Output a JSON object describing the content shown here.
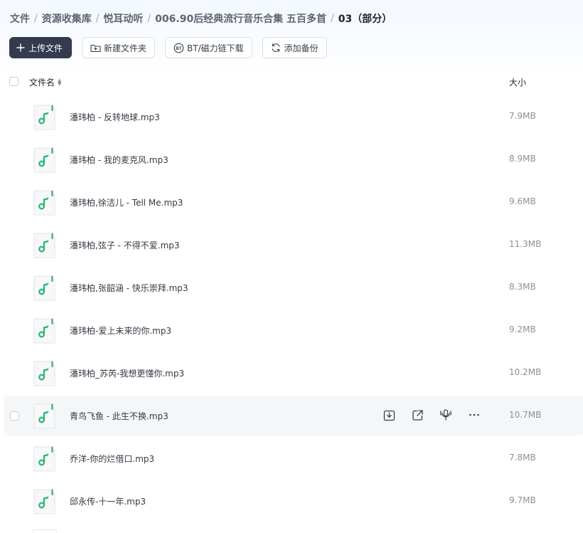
{
  "breadcrumb": [
    {
      "label": "文件"
    },
    {
      "label": "资源收集库"
    },
    {
      "label": "悦耳动听"
    },
    {
      "label": "006.90后经典流行音乐合集 五百多首"
    },
    {
      "label": "03（部分）"
    }
  ],
  "toolbar": {
    "upload_label": "上传文件",
    "new_folder_label": "新建文件夹",
    "bt_label": "BT/磁力链下载",
    "backup_label": "添加备份"
  },
  "table": {
    "col_name": "文件名",
    "col_size": "大小"
  },
  "files": [
    {
      "name": "潘玮柏 - 反转地球.mp3",
      "size": "7.9MB"
    },
    {
      "name": "潘玮柏 - 我的麦克风.mp3",
      "size": "8.9MB"
    },
    {
      "name": "潘玮柏,徐洁儿 - Tell Me.mp3",
      "size": "9.6MB"
    },
    {
      "name": "潘玮柏,弦子 - 不得不爱.mp3",
      "size": "11.3MB"
    },
    {
      "name": "潘玮柏,张韶涵 - 快乐崇拜.mp3",
      "size": "8.3MB"
    },
    {
      "name": "潘玮柏-爱上未来的你.mp3",
      "size": "9.2MB"
    },
    {
      "name": "潘玮柏_苏芮-我想更懂你.mp3",
      "size": "10.2MB"
    },
    {
      "name": "青鸟飞鱼 - 此生不换.mp3",
      "size": "10.7MB"
    },
    {
      "name": "乔洋-你的烂借口.mp3",
      "size": "7.8MB"
    },
    {
      "name": "邱永传-十一年.mp3",
      "size": "9.7MB"
    }
  ],
  "hovered_index": 7,
  "icons": {
    "file": "music-file-icon",
    "accent": "#2bb673"
  }
}
